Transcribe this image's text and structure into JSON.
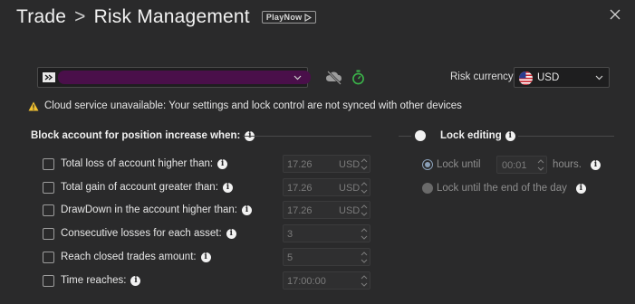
{
  "header": {
    "title_part1": "Trade",
    "separator": ">",
    "title_part2": "Risk Management",
    "playnow_label": "PlayNow"
  },
  "account": {
    "name": "",
    "accent_color": "#4a0f4a"
  },
  "currency": {
    "label": "Risk currency",
    "value": "USD"
  },
  "warning": {
    "text": "Cloud service unavailable: Your settings and lock control are not synced with other devices"
  },
  "block_section": {
    "heading": "Block account for position increase when:",
    "rows": [
      {
        "label": "Total loss of account higher than:",
        "value": "17.26",
        "unit": "USD"
      },
      {
        "label": "Total gain of account greater than:",
        "value": "17.26",
        "unit": "USD"
      },
      {
        "label": "DrawDown in the account higher than:",
        "value": "17.26",
        "unit": "USD"
      },
      {
        "label": "Consecutive losses for each asset:",
        "value": "3",
        "unit": ""
      },
      {
        "label": "Reach closed trades amount:",
        "value": "5",
        "unit": ""
      },
      {
        "label": "Time reaches:",
        "value": "17:00:00",
        "unit": ""
      }
    ]
  },
  "lock_section": {
    "heading": "Lock editing",
    "lock_until_label": "Lock until",
    "lock_until_value": "00:01",
    "hours_label": "hours.",
    "lock_end_of_day_label": "Lock until the end of the day"
  }
}
